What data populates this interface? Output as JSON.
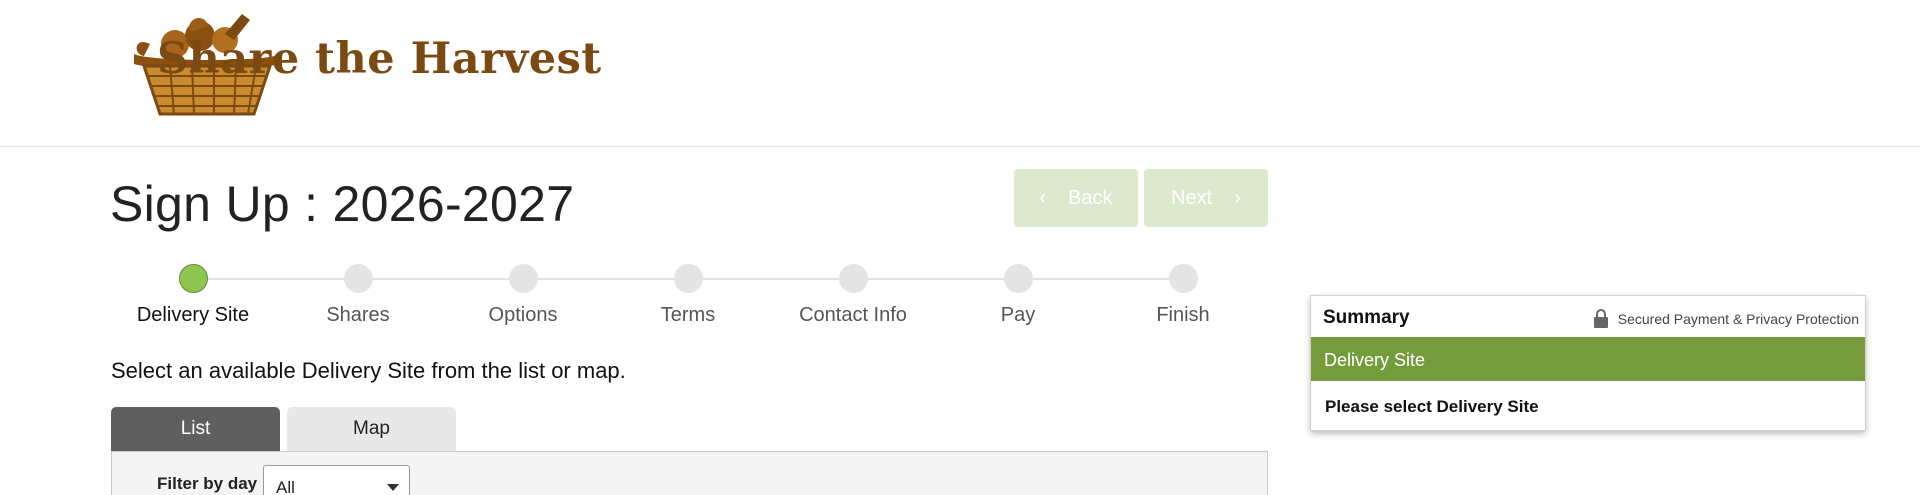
{
  "brand": {
    "name": "Share the Harvest",
    "logo_icon": "basket-of-vegetables-icon",
    "text_color": "#7a4a12"
  },
  "page": {
    "title": "Sign Up : 2026-2027"
  },
  "nav": {
    "back_label": "Back",
    "next_label": "Next",
    "back_icon": "chevron-left-icon",
    "next_icon": "chevron-right-icon",
    "button_color": "#dde9ce"
  },
  "steps": [
    {
      "label": "Delivery Site",
      "active": true
    },
    {
      "label": "Shares",
      "active": false
    },
    {
      "label": "Options",
      "active": false
    },
    {
      "label": "Terms",
      "active": false
    },
    {
      "label": "Contact Info",
      "active": false
    },
    {
      "label": "Pay",
      "active": false
    },
    {
      "label": "Finish",
      "active": false
    }
  ],
  "instruction": "Select an available Delivery Site from the list or map.",
  "tabs": {
    "list_label": "List",
    "map_label": "Map",
    "active": "List"
  },
  "filter": {
    "label": "Filter by day",
    "value": "All"
  },
  "summary": {
    "title": "Summary",
    "secure_text": "Secured Payment & Privacy Protection",
    "secure_icon": "lock-icon",
    "section_label": "Delivery Site",
    "section_color": "#749c3d",
    "empty_text": "Please select Delivery Site"
  },
  "colors": {
    "active_step": "#8ec64f",
    "inactive_step": "#e4e4e4"
  }
}
